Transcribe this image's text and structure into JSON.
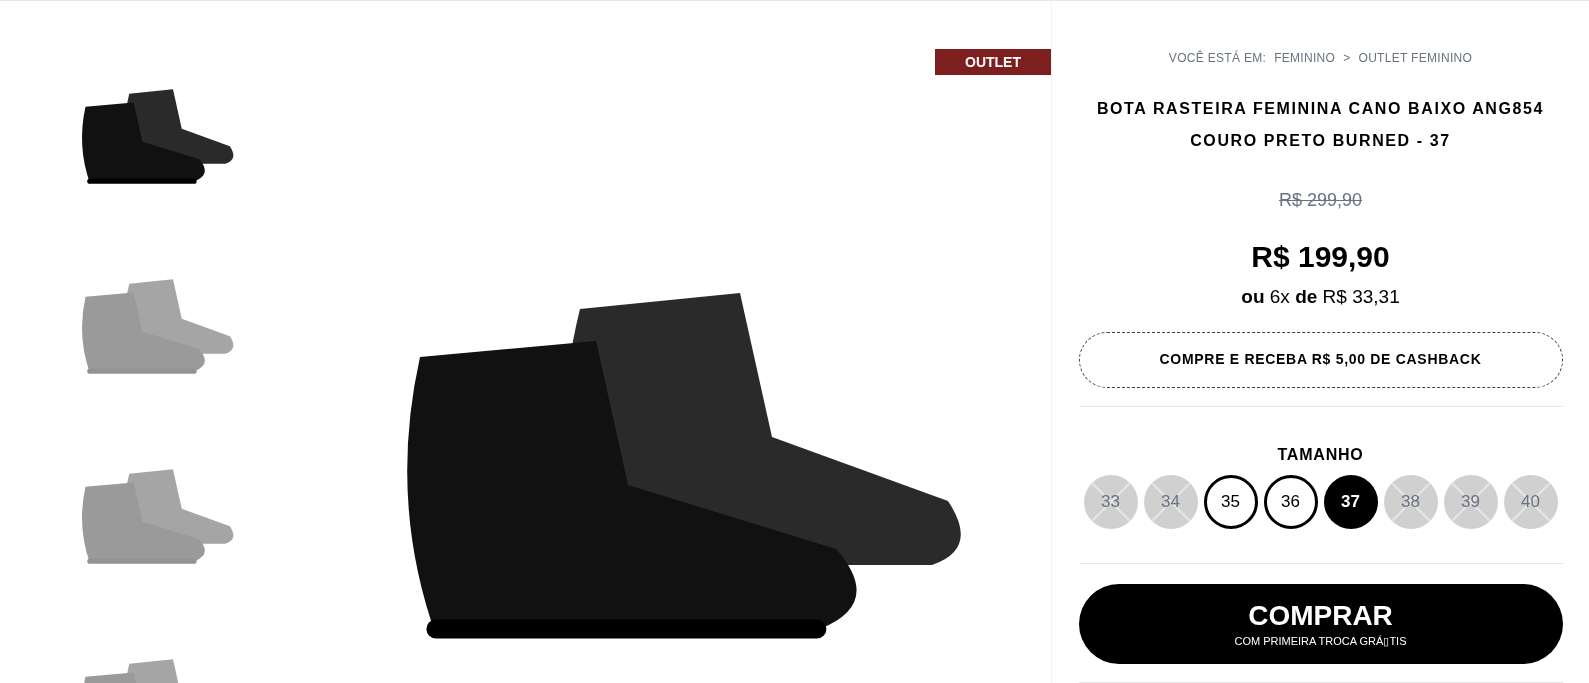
{
  "thumbnails": [
    {
      "selected": true
    },
    {
      "selected": false
    },
    {
      "selected": false
    },
    {
      "selected": false
    }
  ],
  "badge": "OUTLET",
  "breadcrumb": {
    "label": "VOCÊ ESTÁ EM:",
    "items": [
      "FEMININO",
      "OUTLET FEMININO"
    ],
    "separator": ">"
  },
  "title": "BOTA RASTEIRA FEMININA CANO BAIXO ANG854 COURO PRETO BURNED - 37",
  "old_price": "R$ 299,90",
  "price": "R$ 199,90",
  "installments": "**ou** 6x **de** R$ 33,31",
  "cashback": "COMPRE E RECEBA R$ 5,00 DE CASHBACK",
  "size_label": "TAMANHO",
  "sizes": [
    {
      "label": "33",
      "available": false,
      "selected": false
    },
    {
      "label": "34",
      "available": false,
      "selected": false
    },
    {
      "label": "35",
      "available": true,
      "selected": false
    },
    {
      "label": "36",
      "available": true,
      "selected": false
    },
    {
      "label": "37",
      "available": true,
      "selected": true
    },
    {
      "label": "38",
      "available": false,
      "selected": false
    },
    {
      "label": "39",
      "available": false,
      "selected": false
    },
    {
      "label": "40",
      "available": false,
      "selected": false
    }
  ],
  "buy_button": {
    "label": "COMPRAR",
    "sublabel": "COM PRIMEIRA TROCA GRÁ▯TIS"
  }
}
